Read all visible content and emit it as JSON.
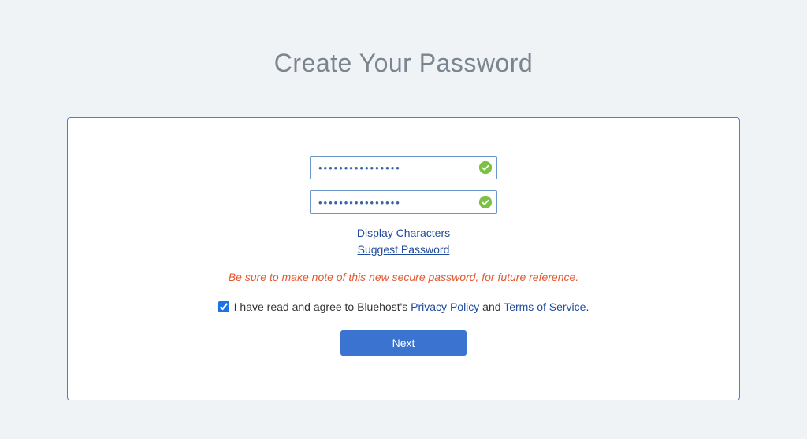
{
  "title": "Create Your Password",
  "password_field": {
    "value": "••••••••••••••••",
    "valid": true
  },
  "confirm_field": {
    "value": "••••••••••••••••",
    "valid": true
  },
  "links": {
    "display_characters": "Display Characters",
    "suggest_password": "Suggest Password"
  },
  "hint": "Be sure to make note of this new secure password, for future reference.",
  "consent": {
    "checked": true,
    "prefix": "I have read and agree to Bluehost's ",
    "privacy_label": "Privacy Policy",
    "middle": " and ",
    "terms_label": "Terms of Service",
    "suffix": "."
  },
  "next_button": "Next"
}
